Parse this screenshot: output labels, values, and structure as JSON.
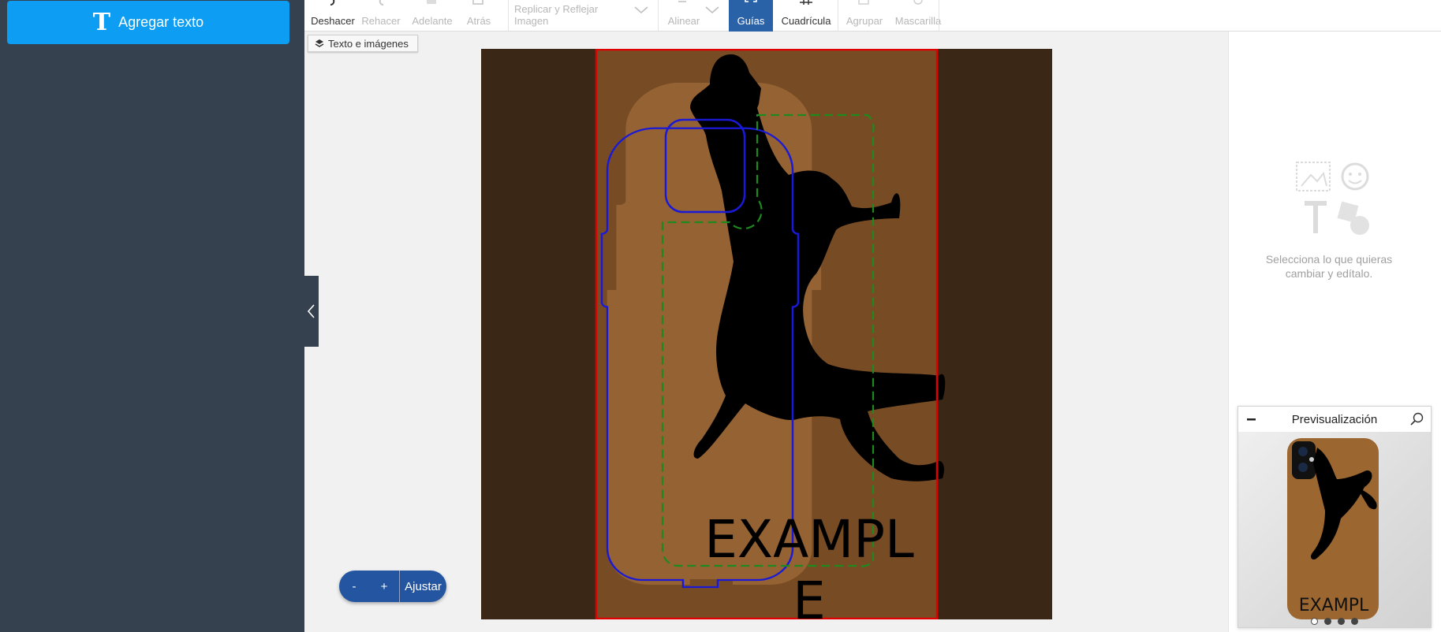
{
  "sidebar": {
    "add_text_label": "Agregar texto"
  },
  "toolbar": {
    "undo": "Deshacer",
    "redo": "Rehacer",
    "forward": "Adelante",
    "backward": "Atrás",
    "replicate": "Replicar y Reflejar Imagen",
    "align": "Alinear",
    "guides": "Guías",
    "grid": "Cuadrícula",
    "group": "Agrupar",
    "mask": "Mascarilla"
  },
  "layers_chip": "Texto e imágenes",
  "canvas": {
    "text_line1": "EXAMPL",
    "text_line2": "E"
  },
  "zoom": {
    "minus": "-",
    "plus": "+",
    "fit": "Ajustar"
  },
  "right_panel": {
    "empty_message": "Selecciona lo que quieras cambiar y edítalo."
  },
  "preview": {
    "title": "Previsualización",
    "text": "EXAMPL",
    "active_dot": 1,
    "dot_count": 4
  },
  "colors": {
    "sidebar_bg": "#35414e",
    "accent_blue": "#0d9ef3",
    "active_tool": "#2a62a8",
    "case_brown": "#956233",
    "guide_red": "#e00000",
    "guide_blue": "#1a1ad6",
    "guide_green": "#1e8a1e"
  }
}
